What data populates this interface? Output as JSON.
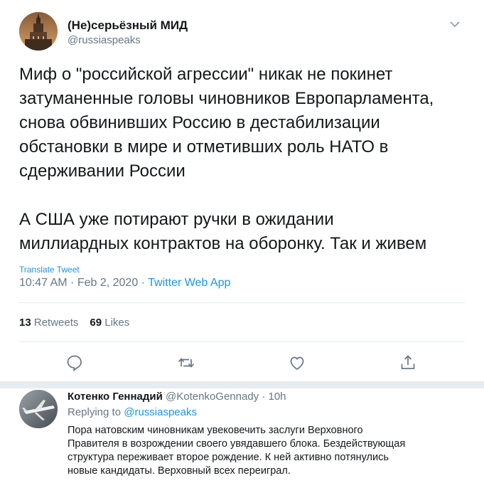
{
  "tweet": {
    "author_name": "(Не)серьёзный МИД",
    "author_handle": "@russiaspeaks",
    "text_lines": [
      "Миф о \"российской агрессии\" никак не покинет",
      "затуманенные головы чиновников Европарламента,",
      "снова обвинивших Россию в дестабилизации",
      "обстановки в мире и отметивших роль НАТО в",
      "сдерживании России",
      "А США уже потирают ручки в ожидании",
      "миллиардных контрактов на оборонку. Так и живем"
    ],
    "translate_label": "Translate Tweet",
    "timestamp": "10:47 AM · Feb 2, 2020 · ",
    "source_app": "Twitter Web App",
    "retweets_count": "13",
    "retweets_label": "Retweets",
    "likes_count": "69",
    "likes_label": "Likes"
  },
  "actions": {
    "reply_icon": "speech-bubble-icon",
    "retweet_icon": "retweet-arrows-icon",
    "like_icon": "heart-icon",
    "share_icon": "share-upload-icon"
  },
  "reply": {
    "author_name": "Котенко Геннадий",
    "author_handle": "@KotenkoGennady",
    "time": " · 10h",
    "replying_prefix": "Replying to ",
    "replying_to": "@russiaspeaks",
    "text_lines": [
      "Пора натовским чиновникам увековечить заслуги Верховного",
      "Правителя в возрождении своего увядавшего блока. Бездействующая",
      "структура переживает второе рождение. К ней активно потянулись",
      "новые кандидаты. Верховный всех переиграл."
    ]
  },
  "colors": {
    "link": "#1b95e0",
    "secondary_text": "#657786",
    "primary_text": "#14171a",
    "divider": "#e6ecf0"
  }
}
